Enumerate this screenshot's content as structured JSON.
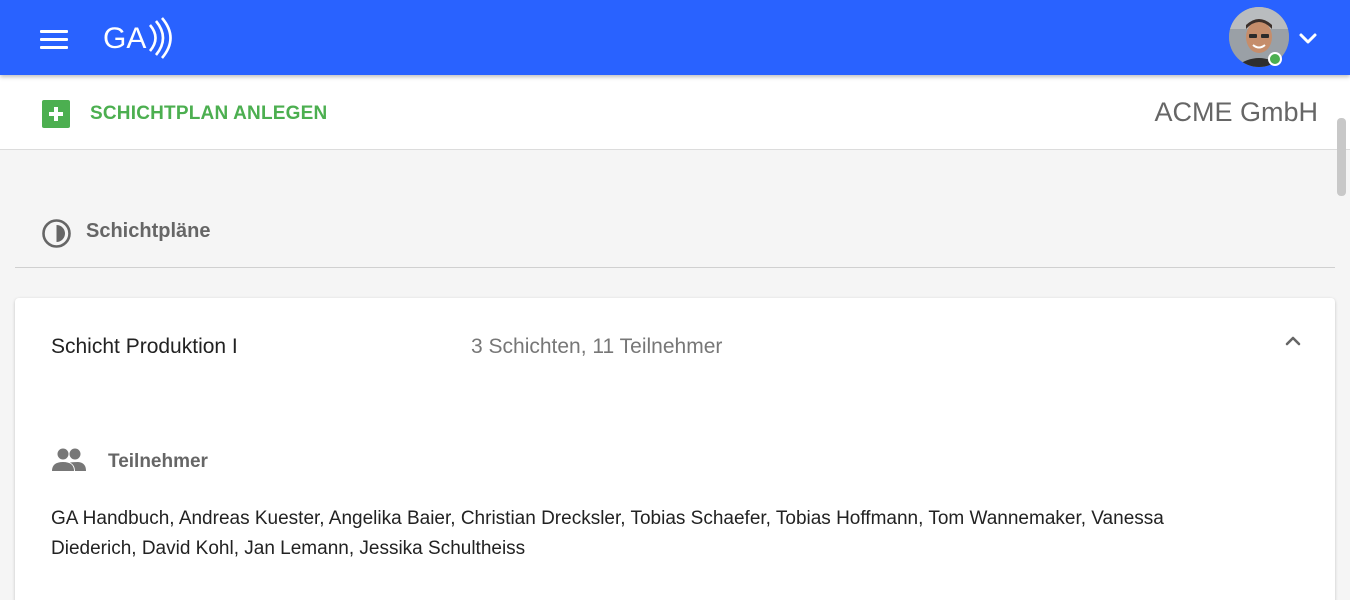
{
  "header": {
    "logo_text": "GA",
    "menu_icon": "hamburger-menu-icon",
    "user_menu_icon": "chevron-down-icon",
    "brand_color": "#2962ff",
    "online_color": "#4caf50"
  },
  "toolbar": {
    "create_label": "SCHICHTPLAN ANLEGEN",
    "create_icon": "plus-box-icon",
    "create_color": "#4caf50",
    "company_name": "ACME GmbH"
  },
  "section": {
    "title": "Schichtpläne",
    "icon": "half-circle-icon"
  },
  "shift_plan": {
    "name": "Schicht Produktion I",
    "summary": "3 Schichten, 11 Teilnehmer",
    "collapse_icon": "chevron-up-icon",
    "participants_label": "Teilnehmer",
    "participants_icon": "people-icon",
    "participants": "GA Handbuch, Andreas Kuester, Angelika Baier, Christian Drecksler, Tobias Schaefer, Tobias Hoffmann, Tom Wannemaker, Vanessa Diederich, David Kohl, Jan Lemann, Jessika Schultheiss"
  }
}
